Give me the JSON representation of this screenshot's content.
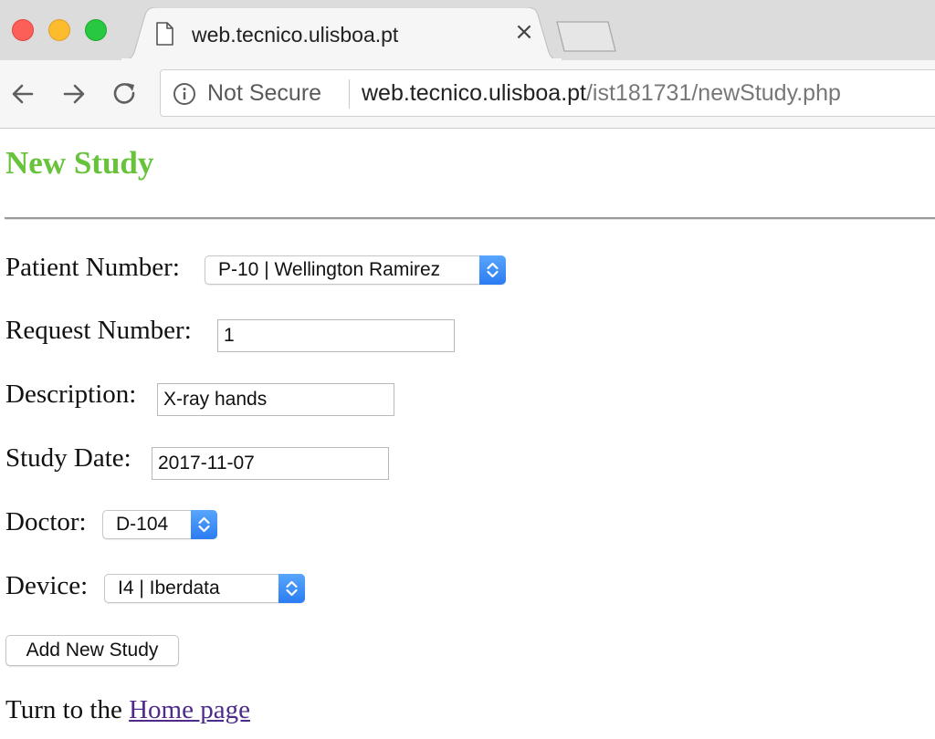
{
  "browser": {
    "tab": {
      "title": "web.tecnico.ulisboa.pt",
      "close_glyph": "×",
      "icon": "document-icon"
    },
    "address_bar": {
      "security_label": "Not Secure",
      "security_icon": "info-icon",
      "url_host": "web.tecnico.ulisboa.pt",
      "url_path": "/ist181731/newStudy.php"
    },
    "nav_icons": [
      "back-arrow-icon",
      "forward-arrow-icon",
      "reload-icon"
    ]
  },
  "page": {
    "title": "New Study",
    "title_color": "#66c33a",
    "form": {
      "patient_number": {
        "label": "Patient Number:",
        "value": "P-10 | Wellington Ramirez"
      },
      "request_number": {
        "label": "Request Number:",
        "value": "1"
      },
      "description": {
        "label": "Description:",
        "value": "X-ray hands"
      },
      "study_date": {
        "label": "Study Date:",
        "value": "2017-11-07"
      },
      "doctor": {
        "label": "Doctor:",
        "value": "D-104"
      },
      "device": {
        "label": "Device:",
        "value": "I4 | Iberdata"
      },
      "submit_label": "Add New Study"
    },
    "footer": {
      "prefix": "Turn to the ",
      "link_text": "Home page",
      "link_color": "#4e2a8a"
    }
  },
  "colors": {
    "select_accent": "#2b7cf2",
    "traffic_red": "#fc5f57",
    "traffic_yellow": "#fdbc2e",
    "traffic_green": "#28c840"
  }
}
